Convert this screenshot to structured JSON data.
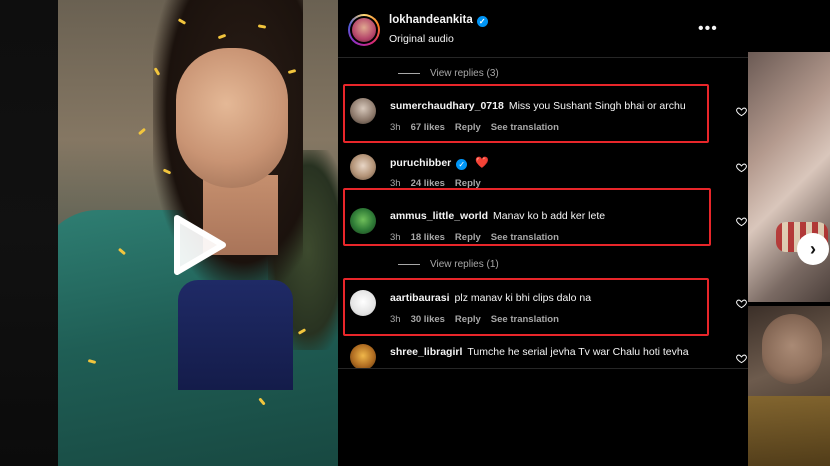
{
  "header": {
    "username": "lokhandeankita",
    "audio": "Original audio",
    "more_icon": "more-horizontal-icon"
  },
  "comments": [
    {
      "type": "view_replies",
      "label": "View replies (3)"
    },
    {
      "type": "comment",
      "user": "sumerchaudhary_0718",
      "text": "Miss you Sushant Singh bhai or archu",
      "time": "3h",
      "likes": "67 likes",
      "reply": "Reply",
      "translate": "See translation",
      "highlighted": true
    },
    {
      "type": "comment",
      "user": "puruchibber",
      "text": "",
      "time": "3h",
      "likes": "24 likes",
      "reply": "Reply",
      "verified": true,
      "emoji": "❤️"
    },
    {
      "type": "comment",
      "user": "ammus_little_world",
      "text": "Manav ko b add ker lete",
      "time": "3h",
      "likes": "18 likes",
      "reply": "Reply",
      "translate": "See translation",
      "highlighted": true
    },
    {
      "type": "view_replies",
      "label": "View replies (1)"
    },
    {
      "type": "comment",
      "user": "aartibaurasi",
      "text": "plz manav ki bhi clips dalo na",
      "time": "3h",
      "likes": "30 likes",
      "reply": "Reply",
      "translate": "See translation",
      "highlighted": true
    },
    {
      "type": "comment",
      "user": "shree_libragirl",
      "text": "Tumche he serial jevha Tv war Chalu hoti tevha",
      "time": "",
      "likes": "",
      "reply": ""
    }
  ],
  "colors": {
    "highlight": "#e8262a",
    "verified": "#0095f6",
    "background": "#000000",
    "muted_text": "#a8a8a8"
  },
  "icons": {
    "play": "play-icon",
    "heart": "heart-outline-icon",
    "next": "chevron-right-icon"
  }
}
